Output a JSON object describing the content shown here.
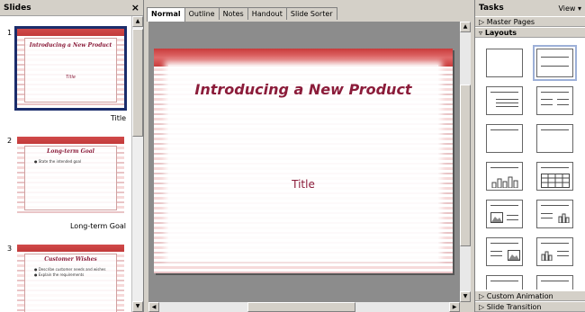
{
  "slides_pane": {
    "title": "Slides",
    "close": "×",
    "slides": [
      {
        "number": "1",
        "title": "Introducing a New Product",
        "subtitle": "Title",
        "caption": "Title"
      },
      {
        "number": "2",
        "title": "Long-term Goal",
        "bullet": "State the intended goal",
        "caption": "Long-term Goal"
      },
      {
        "number": "3",
        "title": "Customer Wishes",
        "bullets": [
          "Describe customer needs and wishes",
          "Explain the requirements"
        ]
      }
    ]
  },
  "editor": {
    "tabs": [
      "Normal",
      "Outline",
      "Notes",
      "Handout",
      "Slide Sorter"
    ],
    "active_tab": "Normal",
    "slide_title": "Introducing a New Product",
    "slide_subtitle": "Title"
  },
  "tasks_pane": {
    "title": "Tasks",
    "view_label": "View ▾",
    "sections": {
      "master_pages": "Master Pages",
      "layouts": "Layouts",
      "custom_animation": "Custom Animation",
      "slide_transition": "Slide Transition"
    },
    "selected_layout": "Title Slide"
  },
  "colors": {
    "accent_red": "#c93b3b",
    "title_text": "#8b1c3a",
    "selection": "#1b2d6b"
  }
}
